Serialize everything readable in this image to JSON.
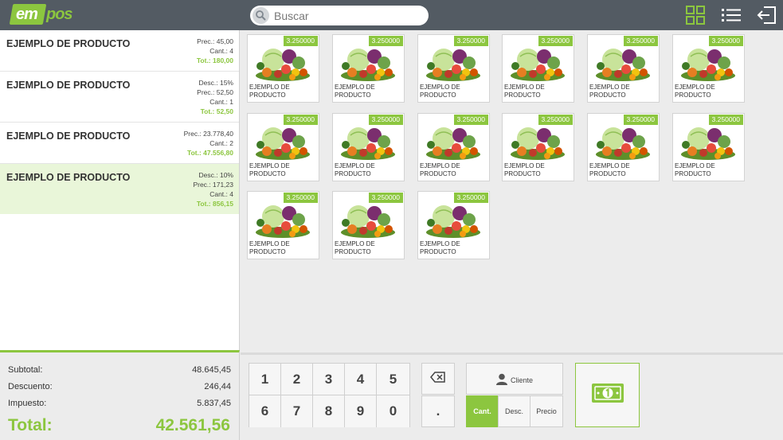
{
  "app": {
    "logo_em": "em",
    "logo_pos": "pos"
  },
  "search": {
    "placeholder": "Buscar",
    "value": ""
  },
  "toolbar": {
    "icons": [
      "grid-view-icon",
      "list-view-icon",
      "logout-icon"
    ],
    "accent": "#8cc63f",
    "bar_color": "#535b63"
  },
  "cart": {
    "items": [
      {
        "name": "EJEMPLO DE PRODUCTO",
        "lines": [
          "Prec.: 45,00",
          "Cant.: 4"
        ],
        "total": "Tot.: 180,00",
        "selected": false
      },
      {
        "name": "EJEMPLO DE PRODUCTO",
        "lines": [
          "Desc.: 15%",
          "Prec.: 52,50",
          "Cant.: 1"
        ],
        "total": "Tot.: 52,50",
        "selected": false
      },
      {
        "name": "EJEMPLO DE PRODUCTO",
        "lines": [
          "Prec.: 23.778,40",
          "Cant.: 2"
        ],
        "total": "Tot.: 47.556,80",
        "selected": false
      },
      {
        "name": "EJEMPLO DE PRODUCTO",
        "lines": [
          "Desc.: 10%",
          "Prec.: 171,23",
          "Cant.: 4"
        ],
        "total": "Tot.: 856,15",
        "selected": true
      }
    ]
  },
  "summary": {
    "subtotal_label": "Subtotal:",
    "subtotal_value": "48.645,45",
    "discount_label": "Descuento:",
    "discount_value": "246,44",
    "tax_label": "Impuesto:",
    "tax_value": "5.837,45",
    "total_label": "Total:",
    "total_value": "42.561,56"
  },
  "products": {
    "items": [
      {
        "price": "3.250000",
        "name": "EJEMPLO DE PRODUCTO"
      },
      {
        "price": "3.250000",
        "name": "EJEMPLO DE PRODUCTO"
      },
      {
        "price": "3.250000",
        "name": "EJEMPLO DE PRODUCTO"
      },
      {
        "price": "3.250000",
        "name": "EJEMPLO DE PRODUCTO"
      },
      {
        "price": "3.250000",
        "name": "EJEMPLO DE PRODUCTO"
      },
      {
        "price": "3.250000",
        "name": "EJEMPLO DE PRODUCTO"
      },
      {
        "price": "3.250000",
        "name": "EJEMPLO DE PRODUCTO"
      },
      {
        "price": "3.250000",
        "name": "EJEMPLO DE PRODUCTO"
      },
      {
        "price": "3.250000",
        "name": "EJEMPLO DE PRODUCTO"
      },
      {
        "price": "3.250000",
        "name": "EJEMPLO DE PRODUCTO"
      },
      {
        "price": "3.250000",
        "name": "EJEMPLO DE PRODUCTO"
      },
      {
        "price": "3.250000",
        "name": "EJEMPLO DE PRODUCTO"
      },
      {
        "price": "3.250000",
        "name": "EJEMPLO DE PRODUCTO"
      },
      {
        "price": "3.250000",
        "name": "EJEMPLO DE PRODUCTO"
      },
      {
        "price": "3.250000",
        "name": "EJEMPLO DE PRODUCTO"
      }
    ]
  },
  "keypad": {
    "keys": [
      "1",
      "2",
      "3",
      "4",
      "5",
      "6",
      "7",
      "8",
      "9",
      "0"
    ],
    "dot": ".",
    "backspace_icon": "backspace-icon"
  },
  "client": {
    "label": "Cliente",
    "icon": "user-icon"
  },
  "modes": [
    {
      "label": "Cant.",
      "active": true
    },
    {
      "label": "Desc.",
      "active": false
    },
    {
      "label": "Precio",
      "active": false
    }
  ],
  "pay": {
    "icon": "cash-icon"
  }
}
